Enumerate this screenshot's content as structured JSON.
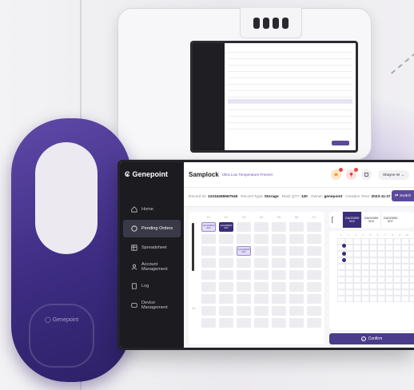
{
  "brand": {
    "name": "Genepoint",
    "logo_icon": "genepoint-logo-icon"
  },
  "sidebar": {
    "items": [
      {
        "label": "Home",
        "icon": "home-icon",
        "active": false
      },
      {
        "label": "Pending Orders",
        "icon": "orders-icon",
        "active": true
      },
      {
        "label": "Spreadsheet",
        "icon": "spreadsheet-icon",
        "active": false
      },
      {
        "label": "Account Management",
        "icon": "account-icon",
        "active": false
      },
      {
        "label": "Log",
        "icon": "log-icon",
        "active": false
      },
      {
        "label": "Device Management",
        "icon": "device-icon",
        "active": false
      }
    ]
  },
  "header": {
    "title": "Samplock",
    "subtitle": "Ultra Low Temperature Freezer",
    "user_label": "Shayne W",
    "icons": [
      "bell-icon",
      "pin-icon",
      "sync-icon"
    ]
  },
  "info": {
    "record_id_label": "Record ID:",
    "record_id": "12334455567545",
    "record_type_label": "Record Type:",
    "record_type": "Storage",
    "rack_qty_label": "Rack QTY:",
    "rack_qty": "120",
    "owner_label": "Owner:",
    "owner": "genepoint",
    "creation_label": "Creation Time:",
    "creation_time": "2023-11-27 16:05:00",
    "switch_label": "Switch"
  },
  "rack": {
    "columns": [
      "01",
      "02",
      "03",
      "04",
      "05",
      "06",
      "07"
    ],
    "row_label": "10",
    "cells": [
      [
        "GCA00000\n002",
        "GCA00000\n004",
        "",
        "",
        "",
        "",
        ""
      ],
      [
        "",
        "",
        "",
        "",
        "",
        "",
        ""
      ],
      [
        "",
        "",
        "GCA00000\n001",
        "",
        "",
        "",
        ""
      ],
      [
        "",
        "",
        "",
        "",
        "",
        "",
        ""
      ],
      [
        "",
        "",
        "",
        "",
        "",
        "",
        ""
      ],
      [
        "",
        "",
        "",
        "",
        "",
        "",
        ""
      ],
      [
        "",
        "",
        "",
        "",
        "",
        "",
        ""
      ],
      [
        "",
        "",
        "",
        "",
        "",
        "",
        ""
      ],
      [
        "",
        "",
        "",
        "",
        "",
        "",
        ""
      ]
    ]
  },
  "boxes": {
    "tabs": [
      {
        "line1": "GAO0000",
        "line2": "002",
        "active": true
      },
      {
        "line1": "GAO0000",
        "line2": "004",
        "active": false
      },
      {
        "line1": "GAO0000",
        "line2": "007",
        "active": false
      }
    ],
    "grid_columns": [
      "1",
      "2",
      "3",
      "4",
      "5",
      "6",
      "7",
      "8",
      "9",
      "10"
    ]
  },
  "confirm_label": "Confirm",
  "handle_logo": "Genepoint",
  "colors": {
    "accent": "#3b2d7a",
    "sidebar": "#1b1b20",
    "handle": "#4a379a"
  }
}
